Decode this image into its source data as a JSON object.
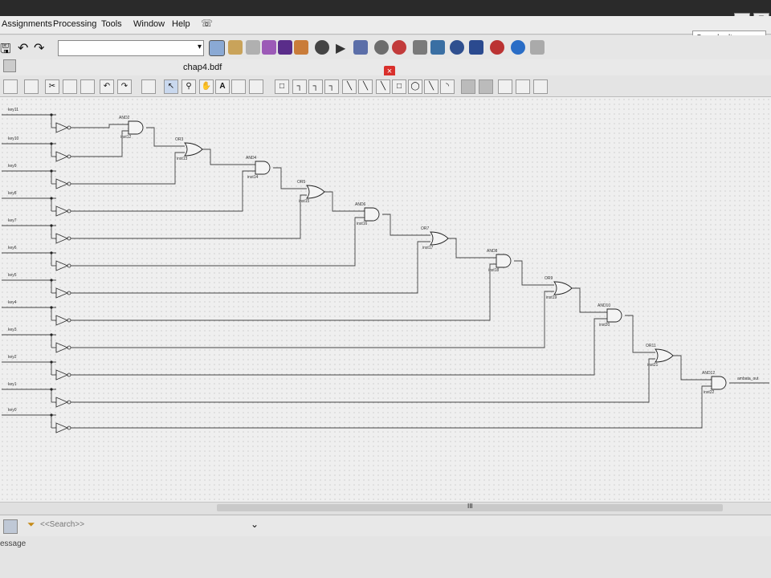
{
  "menubar": [
    "Assignments",
    "Processing",
    "Tools",
    "Window",
    "Help"
  ],
  "search": {
    "placeholder": "Search altera.com"
  },
  "document": {
    "title": "chap4.bdf",
    "close": "×"
  },
  "window_controls": [
    "_",
    "▢"
  ],
  "bottom": {
    "search_placeholder": "<<Search>>",
    "message_label": "essage"
  },
  "scroll_marker": "III",
  "schematic": {
    "inputs": [
      "key11",
      "key10",
      "key9",
      "key8",
      "key7",
      "key6",
      "key5",
      "key4",
      "key3",
      "key2",
      "key1",
      "key0"
    ],
    "gates": [
      {
        "type": "AND",
        "inst": "inst12"
      },
      {
        "type": "OR",
        "inst": "inst13"
      },
      {
        "type": "AND",
        "inst": "inst14"
      },
      {
        "type": "OR",
        "inst": "inst15"
      },
      {
        "type": "AND",
        "inst": "inst16"
      },
      {
        "type": "OR",
        "inst": "inst17"
      },
      {
        "type": "AND",
        "inst": "inst18"
      },
      {
        "type": "OR",
        "inst": "inst19"
      },
      {
        "type": "AND",
        "inst": "inst20"
      },
      {
        "type": "OR",
        "inst": "inst21"
      },
      {
        "type": "AND",
        "inst": "inst22"
      }
    ],
    "output": "ambata_out"
  }
}
